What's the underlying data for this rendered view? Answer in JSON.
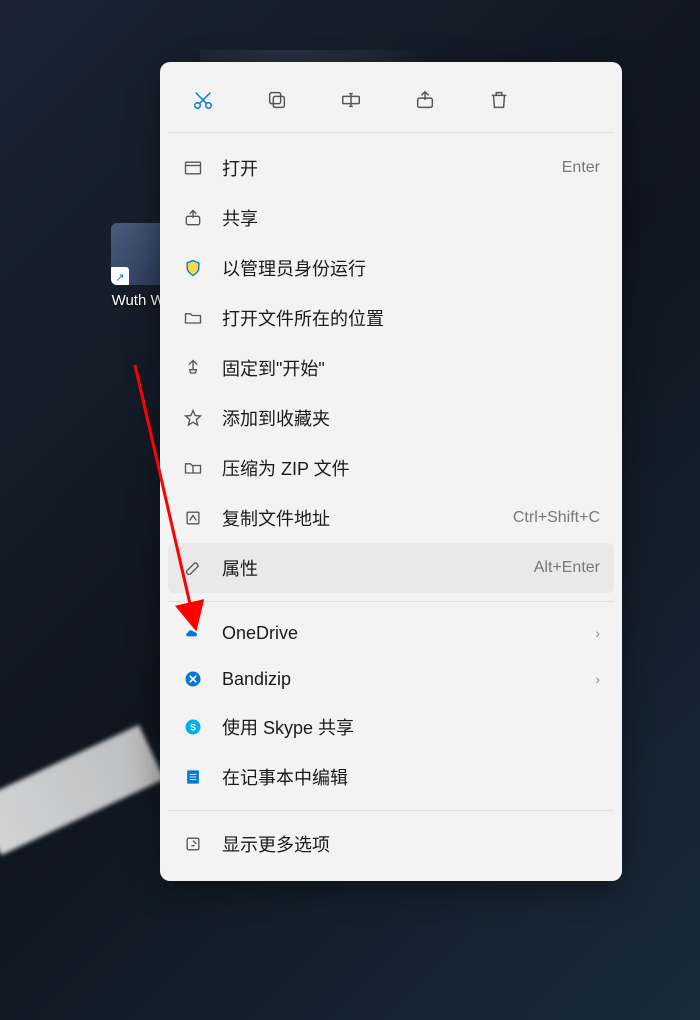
{
  "desktop": {
    "icon_label": "Wuth\nWa"
  },
  "toolbar": {
    "cut": "剪切",
    "copy": "复制",
    "rename": "重命名",
    "share": "共享",
    "delete": "删除"
  },
  "menu": {
    "open": {
      "label": "打开",
      "shortcut": "Enter"
    },
    "share": {
      "label": "共享"
    },
    "run_admin": {
      "label": "以管理员身份运行"
    },
    "open_location": {
      "label": "打开文件所在的位置"
    },
    "pin_start": {
      "label": "固定到\"开始\""
    },
    "add_favorites": {
      "label": "添加到收藏夹"
    },
    "compress_zip": {
      "label": "压缩为 ZIP 文件"
    },
    "copy_path": {
      "label": "复制文件地址",
      "shortcut": "Ctrl+Shift+C"
    },
    "properties": {
      "label": "属性",
      "shortcut": "Alt+Enter"
    },
    "onedrive": {
      "label": "OneDrive"
    },
    "bandizip": {
      "label": "Bandizip"
    },
    "skype_share": {
      "label": "使用 Skype 共享"
    },
    "notepad_edit": {
      "label": "在记事本中编辑"
    },
    "more_options": {
      "label": "显示更多选项"
    }
  },
  "colors": {
    "accent": "#0078d4",
    "menu_bg": "#f3f3f3",
    "highlight": "#e9e9e9"
  }
}
